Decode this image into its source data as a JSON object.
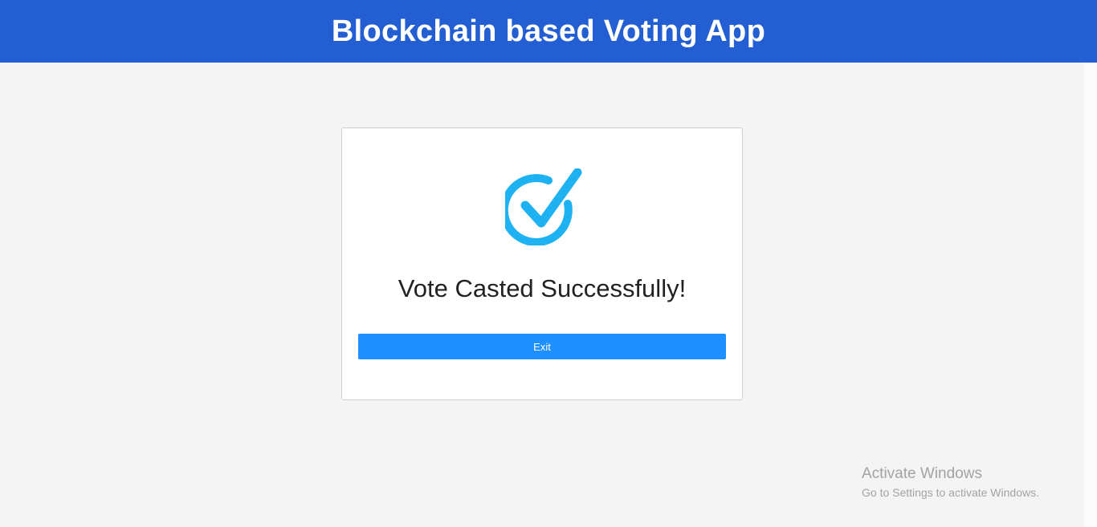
{
  "header": {
    "title": "Blockchain based Voting App"
  },
  "card": {
    "icon": "check-circle-icon",
    "message": "Vote Casted Successfully!",
    "exit_label": "Exit"
  },
  "watermark": {
    "title": "Activate Windows",
    "subtitle": "Go to Settings to activate Windows."
  },
  "colors": {
    "header_bg": "#235fd3",
    "accent_button": "#1e90ff",
    "check_icon": "#1eb2f2",
    "page_bg": "#f4f4f4"
  }
}
